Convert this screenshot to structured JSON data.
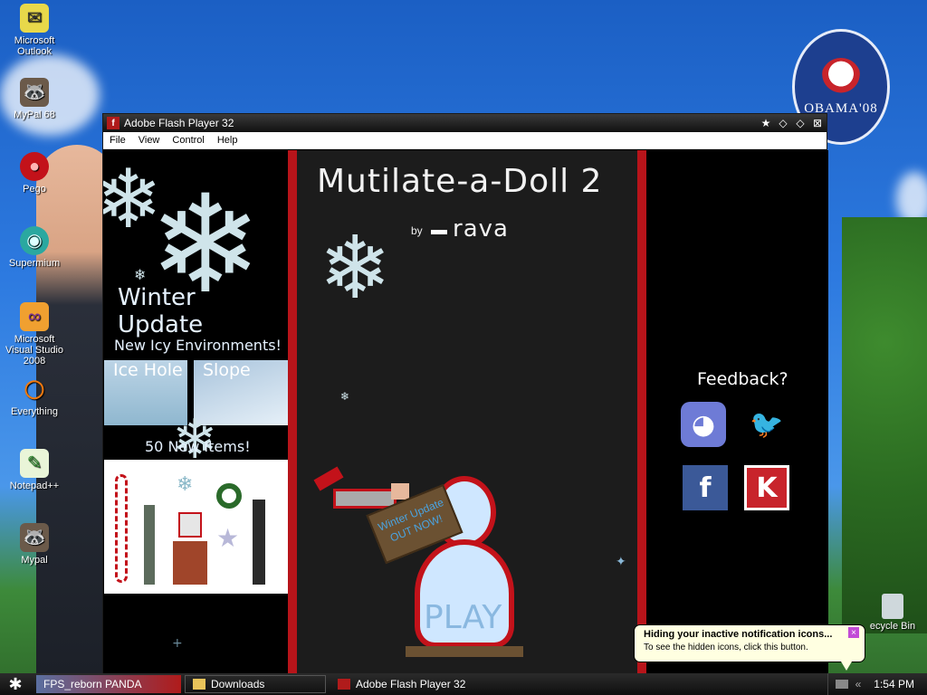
{
  "desktop": {
    "icons": [
      {
        "label": "Microsoft Outlook",
        "icon": "outlook-icon",
        "glyph": "✉"
      },
      {
        "label": "MyPal 68",
        "icon": "mypal-icon",
        "glyph": "🦝"
      },
      {
        "label": "Pego",
        "icon": "pego-icon",
        "glyph": "●"
      },
      {
        "label": "Supermium",
        "icon": "supermium-icon",
        "glyph": "◉"
      },
      {
        "label": "Microsoft Visual Studio 2008",
        "icon": "visual-studio-icon",
        "glyph": "∞"
      },
      {
        "label": "Everything",
        "icon": "everything-icon",
        "glyph": "◯"
      },
      {
        "label": "Notepad++",
        "icon": "notepadpp-icon",
        "glyph": "✎"
      },
      {
        "label": "Mypal",
        "icon": "mypal2-icon",
        "glyph": "🦝"
      }
    ],
    "recycle_bin_label": "ecycle Bin",
    "badge": "OBAMA'08"
  },
  "window": {
    "title": "Adobe Flash Player 32",
    "app_icon": "f",
    "menu": [
      "File",
      "View",
      "Control",
      "Help"
    ]
  },
  "game": {
    "title": "Mutilate-a-Doll 2",
    "by": "by",
    "author": "rava",
    "left": {
      "winter_update": "Winter Update",
      "new_envs": "New Icy Environments!",
      "env1": "Ice Hole",
      "env2": "Slope",
      "new_items": "50 New Items!"
    },
    "sign_text": "Winter Update OUT NOW!",
    "play": "PLAY",
    "feedback": "Feedback?",
    "social": [
      {
        "name": "discord",
        "color": "#6e7bd6",
        "glyph": "◕"
      },
      {
        "name": "twitter",
        "color": "#1da1f2",
        "glyph": "🐦"
      },
      {
        "name": "facebook",
        "color": "#3b5998",
        "glyph": "f"
      },
      {
        "name": "kongregate",
        "color": "#c8242b",
        "glyph": "K"
      }
    ]
  },
  "taskbar": {
    "start_glyph": "✱",
    "quick_item": "FPS_reborn PANDA",
    "tasks": [
      {
        "label": "Downloads",
        "icon": "folder-icon",
        "color": "#e8c35a"
      },
      {
        "label": "Adobe Flash Player 32",
        "icon": "flash-icon",
        "color": "#b01b1b"
      }
    ],
    "time": "1:54 PM"
  },
  "balloon": {
    "title": "Hiding your inactive notification icons...",
    "text": "To see the hidden icons, click this button."
  }
}
